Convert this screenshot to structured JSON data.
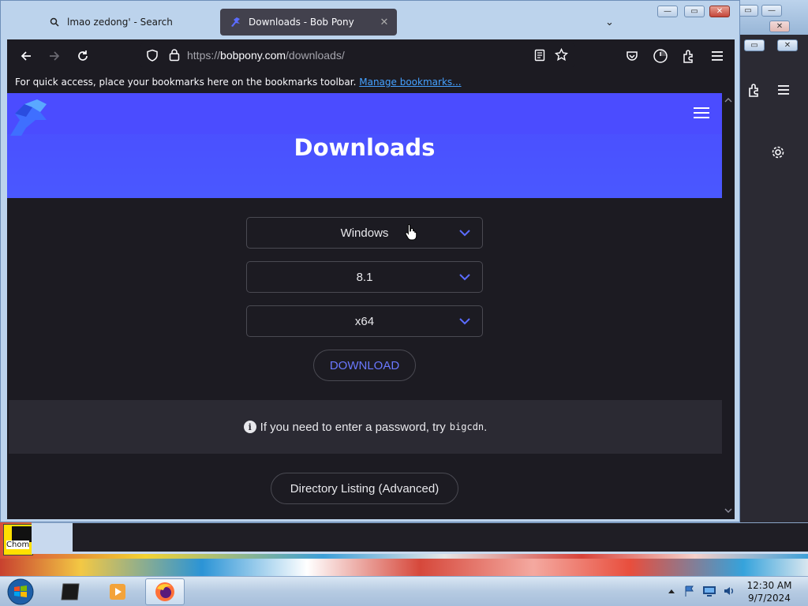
{
  "browser": {
    "tabs": [
      {
        "label": "lmao zedong' - Search",
        "close": "✕"
      },
      {
        "label": "Downloads - Bob Pony",
        "close": "✕"
      }
    ],
    "tab_list_glyph": "⌄",
    "url": {
      "protocol": "https://",
      "host": "bobpony.com",
      "path": "/downloads/"
    },
    "bookmarks_bar": {
      "message": "For quick access, place your bookmarks here on the bookmarks toolbar.",
      "link": "Manage bookmarks..."
    }
  },
  "page": {
    "title": "Downloads",
    "selects": {
      "os": "Windows",
      "version": "8.1",
      "arch": "x64"
    },
    "download_button": "DOWNLOAD",
    "notice": {
      "info_glyph": "i",
      "text": "If you need to enter a password, try",
      "password": "bigcdn",
      "suffix": "."
    },
    "directory_button": "Directory Listing (Advanced)"
  },
  "desktop": {
    "shortcut_label": "Chom"
  },
  "taskbar": {
    "time": "12:30 AM",
    "date": "9/7/2024"
  },
  "colors": {
    "accent": "#4b4cff",
    "link": "#45a1ff",
    "download_text": "#6a78ff",
    "page_bg": "#1c1b22"
  }
}
